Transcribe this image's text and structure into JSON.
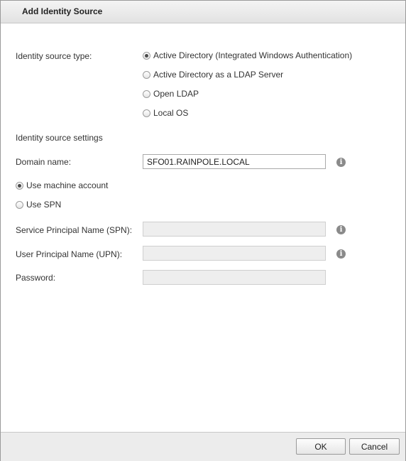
{
  "dialog": {
    "title": "Add Identity Source"
  },
  "source_type": {
    "label": "Identity source type:",
    "options": [
      {
        "label": "Active Directory (Integrated Windows Authentication)",
        "selected": true
      },
      {
        "label": "Active Directory as a LDAP Server",
        "selected": false
      },
      {
        "label": "Open LDAP",
        "selected": false
      },
      {
        "label": "Local OS",
        "selected": false
      }
    ]
  },
  "settings": {
    "heading": "Identity source settings",
    "domain_label": "Domain name:",
    "domain_value": "SFO01.RAINPOLE.LOCAL",
    "account_options": [
      {
        "label": "Use machine account",
        "selected": true
      },
      {
        "label": "Use SPN",
        "selected": false
      }
    ],
    "spn_label": "Service Principal Name (SPN):",
    "spn_value": "",
    "upn_label": "User Principal Name (UPN):",
    "upn_value": "",
    "password_label": "Password:",
    "password_value": ""
  },
  "icons": {
    "info": "info-icon",
    "info_glyph": "i"
  },
  "footer": {
    "ok_label": "OK",
    "cancel_label": "Cancel"
  }
}
